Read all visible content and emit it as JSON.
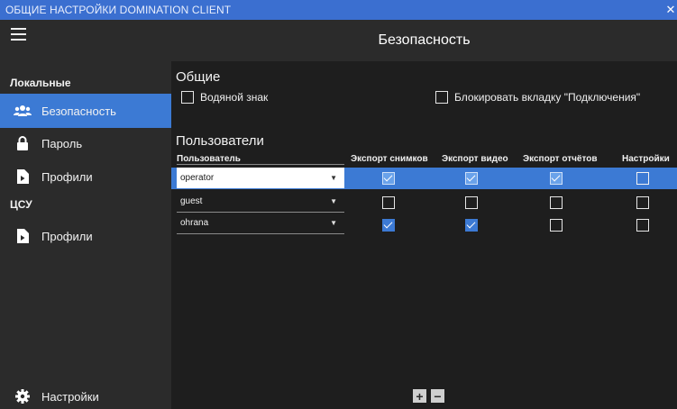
{
  "window": {
    "title": "ОБЩИЕ НАСТРОЙКИ DOMINATION CLIENT",
    "close_glyph": "✕"
  },
  "header": {
    "title": "Безопасность"
  },
  "sidebar": {
    "groups": [
      {
        "title": "Локальные",
        "items": [
          {
            "label": "Безопасность",
            "icon": "users-icon",
            "active": true
          },
          {
            "label": "Пароль",
            "icon": "lock-icon",
            "active": false
          },
          {
            "label": "Профили",
            "icon": "profile-file-icon",
            "active": false
          }
        ]
      },
      {
        "title": "ЦСУ",
        "items": [
          {
            "label": "Профили",
            "icon": "profile-file-icon",
            "active": false
          }
        ]
      }
    ],
    "settings": {
      "label": "Настройки",
      "icon": "gear-icon"
    }
  },
  "general": {
    "title": "Общие",
    "watermark_label": "Водяной знак",
    "watermark_checked": false,
    "block_connections_label": "Блокировать вкладку \"Подключения\"",
    "block_connections_checked": false
  },
  "users": {
    "title": "Пользователи",
    "columns": [
      "Пользователь",
      "Экспорт снимков",
      "Экспорт видео",
      "Экспорт отчётов",
      "Настройки"
    ],
    "rows": [
      {
        "user": "operator",
        "selected": true,
        "snapshots": true,
        "video": true,
        "reports": true,
        "settings": false
      },
      {
        "user": "guest",
        "selected": false,
        "snapshots": false,
        "video": false,
        "reports": false,
        "settings": false
      },
      {
        "user": "ohrana",
        "selected": false,
        "snapshots": true,
        "video": true,
        "reports": false,
        "settings": false
      }
    ],
    "add_label": "+",
    "remove_label": "−"
  },
  "colors": {
    "accent": "#3c7ad4",
    "titlebar": "#3b6fd0",
    "sidebar": "#2b2b2b",
    "background": "#1e1e1e"
  }
}
